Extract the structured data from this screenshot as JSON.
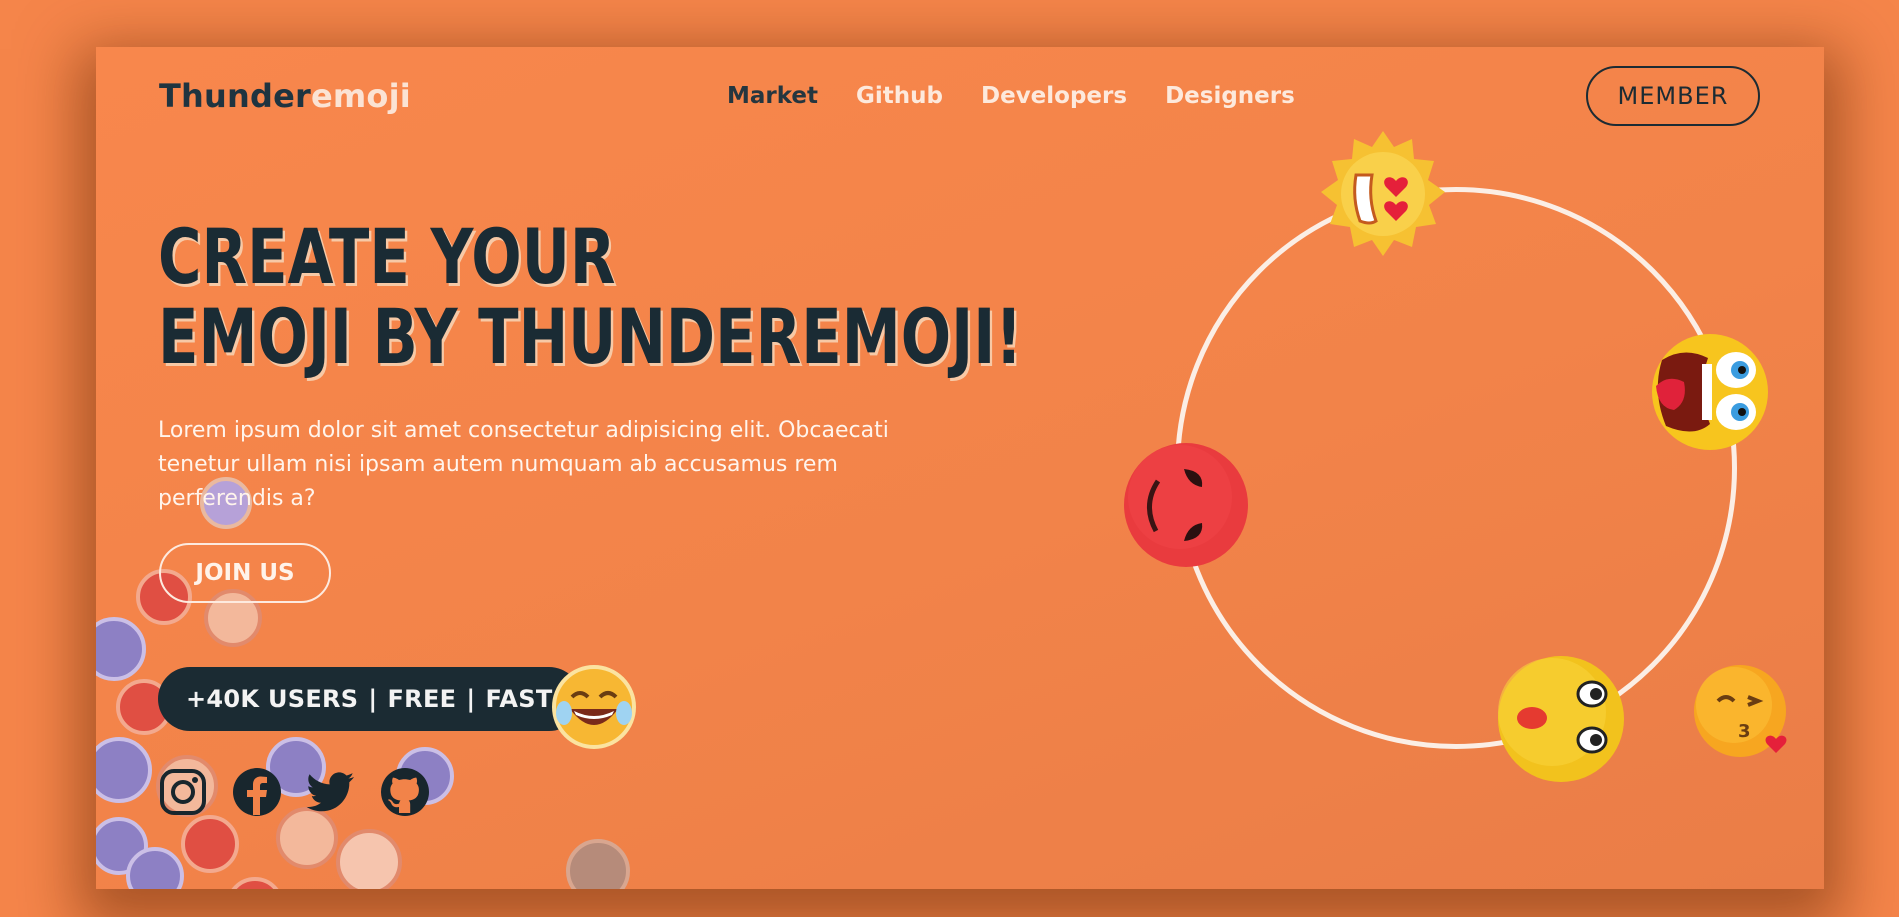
{
  "brand": {
    "part1": "Thunder",
    "part2": "emoji"
  },
  "nav": {
    "items": [
      {
        "label": "Market"
      },
      {
        "label": "Github"
      },
      {
        "label": "Developers"
      },
      {
        "label": "Designers"
      }
    ]
  },
  "header": {
    "member_label": "MEMBER"
  },
  "hero": {
    "title_line1": "CREATE YOUR",
    "title_line2": "EMOJI BY THUNDEREMOJI!",
    "description": "Lorem ipsum dolor sit amet consectetur adipisicing elit. Obcaecati tenetur ullam nisi ipsam autem numquam ab accusamus rem perferendis a?",
    "join_label": "JOIN US"
  },
  "stats": {
    "users": "+40K USERS",
    "free": "FREE",
    "fast": "FAST",
    "separator": "|"
  },
  "social": [
    "instagram-icon",
    "facebook-icon",
    "twitter-icon",
    "github-icon"
  ],
  "colors": {
    "background": "#f5854a",
    "dark": "#1b2b33",
    "light_text": "#fde9dc",
    "orbit_ring": "#fbeee5"
  }
}
